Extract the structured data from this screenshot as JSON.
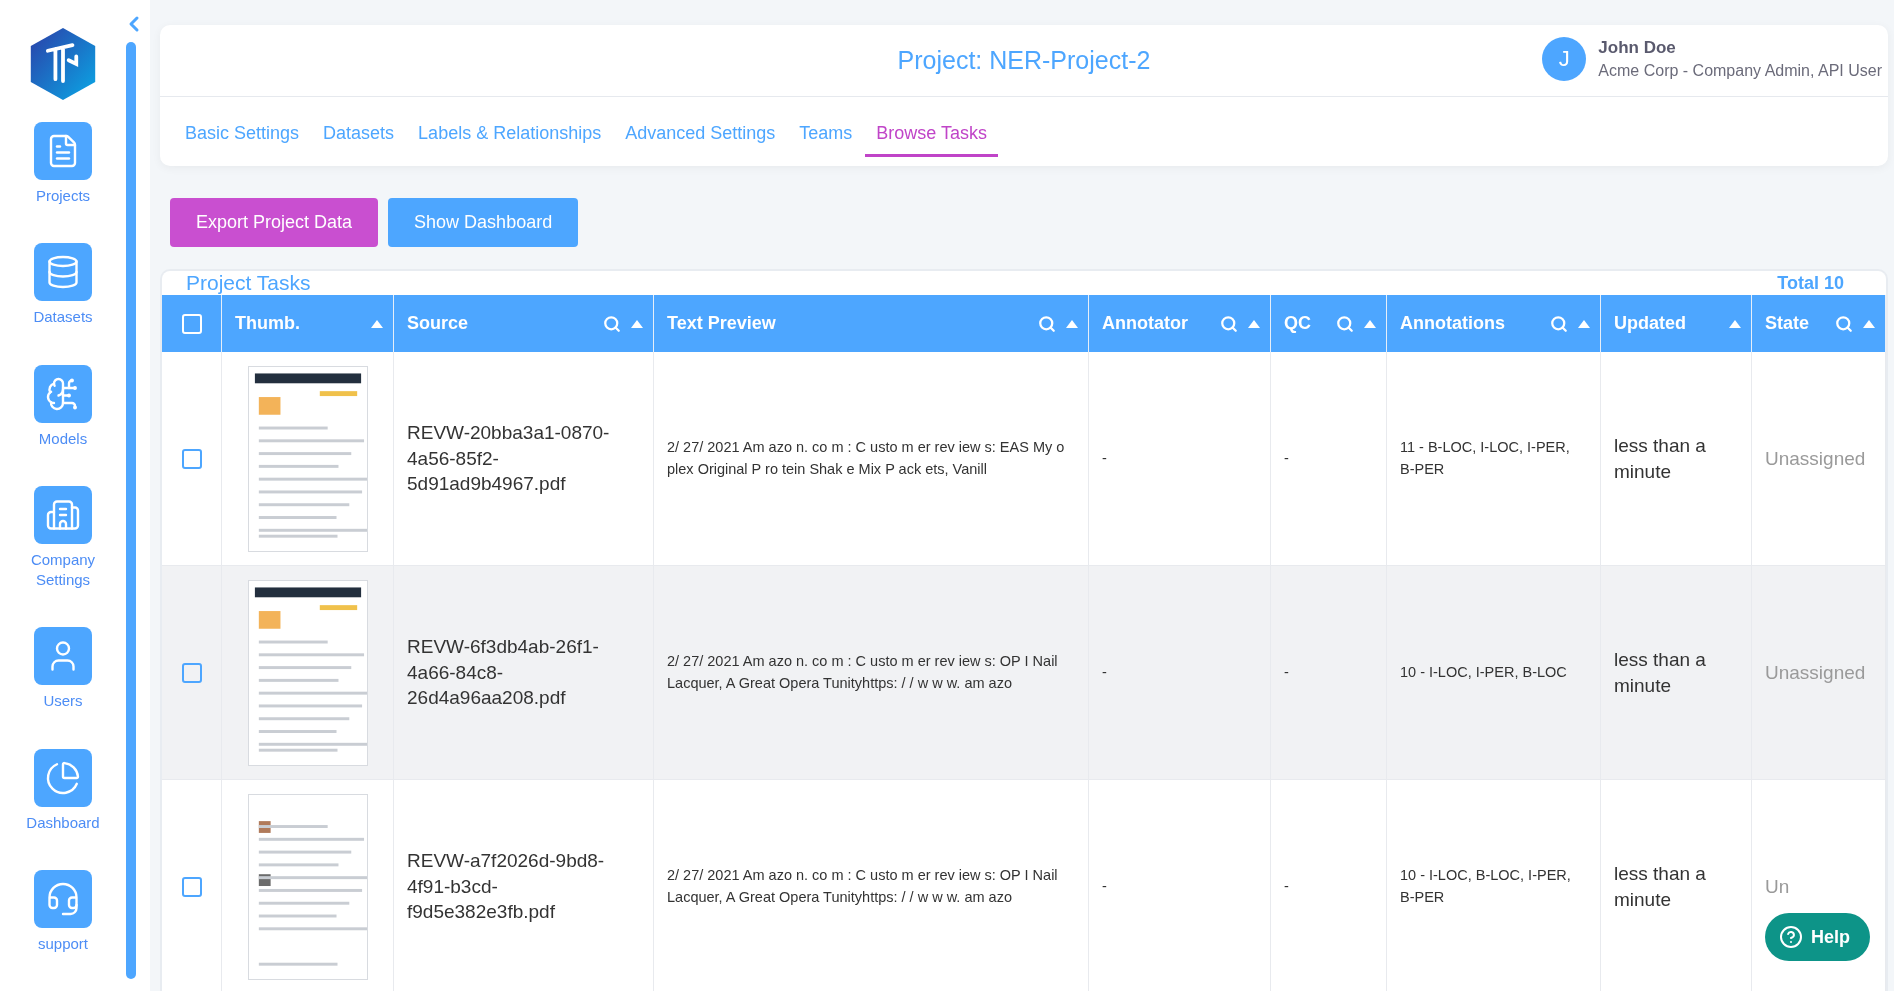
{
  "sidebar": {
    "items": [
      {
        "label": "Projects",
        "selected": false
      },
      {
        "label": "Datasets",
        "selected": false
      },
      {
        "label": "Models",
        "selected": false
      },
      {
        "label": "Company Settings",
        "selected": false
      },
      {
        "label": "Users",
        "selected": false
      },
      {
        "label": "Dashboard",
        "selected": false
      },
      {
        "label": "support",
        "selected": false
      }
    ]
  },
  "header": {
    "title": "Project: NER-Project-2",
    "user": {
      "initial": "J",
      "name": "John Doe",
      "role": "Acme Corp - Company Admin, API User"
    }
  },
  "tabs": [
    {
      "label": "Basic Settings",
      "selected": false
    },
    {
      "label": "Datasets",
      "selected": false
    },
    {
      "label": "Labels & Relationships",
      "selected": false
    },
    {
      "label": "Advanced Settings",
      "selected": false
    },
    {
      "label": "Teams",
      "selected": false
    },
    {
      "label": "Browse Tasks",
      "selected": true
    }
  ],
  "actions": [
    {
      "label": "Export Project Data",
      "kind": "primary"
    },
    {
      "label": "Show Dashboard",
      "kind": "secondary"
    }
  ],
  "tasks": {
    "title": "Project Tasks",
    "total": "Total 10",
    "select_all_checked": false,
    "columns": [
      {
        "label": "Thumb.",
        "searchable": false,
        "sortable": true
      },
      {
        "label": "Source",
        "searchable": true,
        "sortable": true
      },
      {
        "label": "Text Preview",
        "searchable": true,
        "sortable": true
      },
      {
        "label": "Annotator",
        "searchable": true,
        "sortable": true
      },
      {
        "label": "QC",
        "searchable": true,
        "sortable": true
      },
      {
        "label": "Annotations",
        "searchable": true,
        "sortable": true
      },
      {
        "label": "Updated",
        "searchable": false,
        "sortable": true
      },
      {
        "label": "State",
        "searchable": true,
        "sortable": true
      }
    ],
    "rows": [
      {
        "checked": false,
        "source": "REVW-20bba3a1-0870-4a56-85f2-5d91ad9b4967.pdf",
        "text_preview": "2/ 27/ 2021 Am azo n. co m : C usto m er rev iew s: EAS My o plex Original P ro tein Shak e Mix P ack ets, Vanill",
        "annotator": "-",
        "qc": "-",
        "annotations": "11 - B-LOC, I-LOC, I-PER, B-PER",
        "updated": "less than a minute",
        "state": "Unassigned"
      },
      {
        "checked": false,
        "source": "REVW-6f3db4ab-26f1-4a66-84c8-26d4a96aa208.pdf",
        "text_preview": "2/ 27/ 2021 Am azo n. co m : C usto m er rev iew s: OP I Nail Lacquer, A Great Opera Tunityhttps: / / w w w. am azo",
        "annotator": "-",
        "qc": "-",
        "annotations": "10 - I-LOC, I-PER, B-LOC",
        "updated": "less than a minute",
        "state": "Unassigned"
      },
      {
        "checked": false,
        "source": "REVW-a7f2026d-9bd8-4f91-b3cd-f9d5e382e3fb.pdf",
        "text_preview": "2/ 27/ 2021 Am azo n. co m : C usto m er rev iew s: OP I Nail Lacquer, A Great Opera Tunityhttps: / / w w w. am azo",
        "annotator": "-",
        "qc": "-",
        "annotations": "10 - I-LOC, B-LOC, I-PER, B-PER",
        "updated": "less than a minute",
        "state": "Un"
      }
    ]
  },
  "help": {
    "label": "Help"
  }
}
